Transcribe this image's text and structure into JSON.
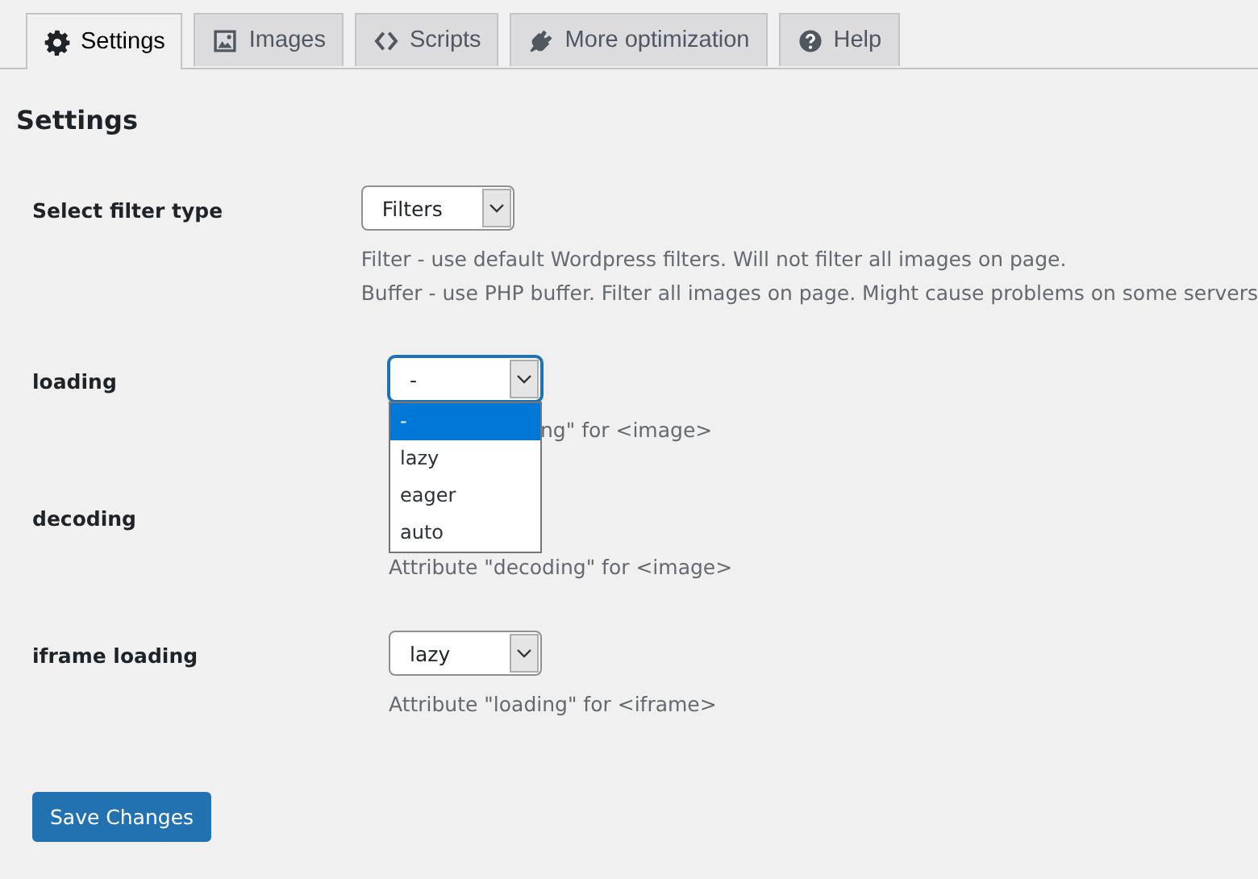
{
  "tabs": [
    {
      "label": "Settings",
      "kind": "gear",
      "selected": true
    },
    {
      "label": "Images",
      "kind": "image",
      "selected": false
    },
    {
      "label": "Scripts",
      "kind": "code",
      "selected": false
    },
    {
      "label": "More optimization",
      "kind": "plug",
      "selected": false
    },
    {
      "label": "Help",
      "kind": "help",
      "selected": false
    }
  ],
  "heading": "Settings",
  "fields": [
    {
      "label": "Select filter type",
      "select": {
        "value": "Filters",
        "focused": false
      },
      "description": [
        "Filter - use default Wordpress filters. Will not filter all images on page.",
        "Buffer - use PHP buffer. Filter all images on page. Might cause problems on some servers"
      ]
    },
    {
      "label": "loading",
      "select": {
        "value": "-",
        "focused": true,
        "dropdown": [
          {
            "label": "-",
            "selected": true
          },
          {
            "label": "lazy",
            "selected": false
          },
          {
            "label": "eager",
            "selected": false
          },
          {
            "label": "auto",
            "selected": false
          }
        ]
      },
      "description": [
        "ng\" for <image>"
      ]
    },
    {
      "label": "decoding",
      "description": [
        "Attribute \"decoding\" for <image>"
      ]
    },
    {
      "label": "iframe loading",
      "select": {
        "value": "lazy",
        "focused": false
      },
      "description": [
        "Attribute \"loading\" for <iframe>"
      ]
    }
  ],
  "save_button": "Save Changes"
}
